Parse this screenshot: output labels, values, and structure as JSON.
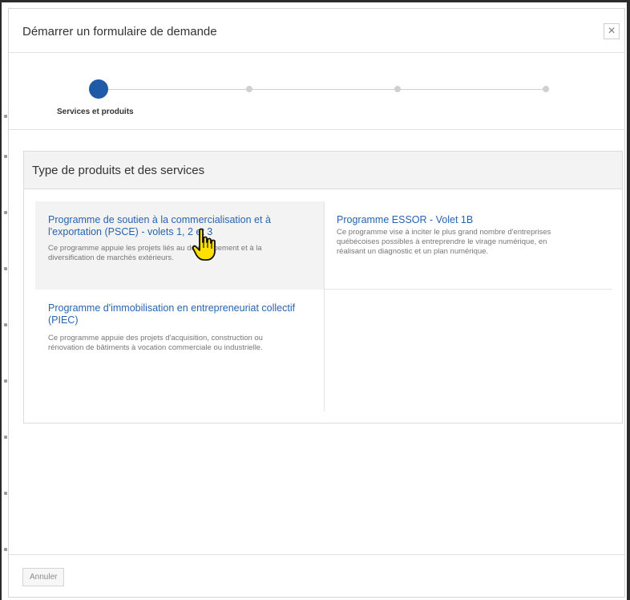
{
  "dialog": {
    "title": "Démarrer un formulaire de demande",
    "close_icon": "close-icon",
    "close_label": "×"
  },
  "stepper": {
    "active_step_label": "Services et produits",
    "total_steps": 4,
    "current_step": 1,
    "active_color": "#1f5aa6"
  },
  "panel": {
    "title": "Type de produits et des services",
    "cards": [
      {
        "title": "Programme de soutien à la commercialisation et à l'exportation (PSCE) - volets 1, 2 et 3",
        "description": "Ce programme appuie les projets liés au développement et à la diversification de marchés extérieurs."
      },
      {
        "title": "Programme ESSOR - Volet 1B",
        "description": "Ce programme vise à inciter le plus grand nombre d'entreprises québécoises possibles à entreprendre le virage numérique, en réalisant un diagnostic et un plan numérique."
      },
      {
        "title": "Programme d'immobilisation en entrepreneuriat collectif (PIEC)",
        "description": "Ce programme appuie des projets d'acquisition, construction ou rénovation de bâtiments à vocation commerciale ou industrielle."
      }
    ]
  },
  "footer": {
    "cancel_label": "Annuler"
  },
  "colors": {
    "link": "#2764b0",
    "hover_card_bg": "#f3f3f3",
    "cursor": "#ffe000"
  },
  "cursor_icon": "hand-pointer-icon"
}
